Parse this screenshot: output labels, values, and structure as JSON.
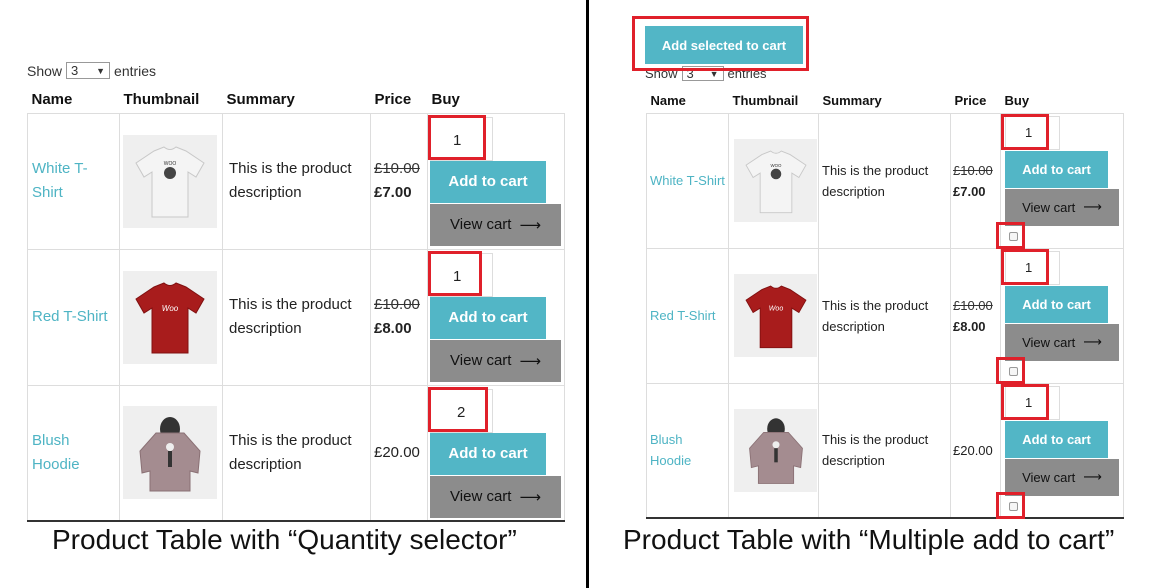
{
  "left": {
    "show_label": "Show",
    "entries_value": "3",
    "entries_label": "entries",
    "headers": {
      "name": "Name",
      "thumbnail": "Thumbnail",
      "summary": "Summary",
      "price": "Price",
      "buy": "Buy"
    },
    "rows": [
      {
        "name_line1": "White T-",
        "name_line2": "Shirt",
        "summary_line1": "This is the product",
        "summary_line2": "description",
        "price_old": "£10.00",
        "price_new": "£7.00",
        "qty": "1",
        "add_label": "Add to cart",
        "view_label": "View cart",
        "thumb_icon": "white-tshirt-image"
      },
      {
        "name_line1": "Red T-Shirt",
        "name_line2": "",
        "summary_line1": "This is the product",
        "summary_line2": "description",
        "price_old": "£10.00",
        "price_new": "£8.00",
        "qty": "1",
        "add_label": "Add to cart",
        "view_label": "View cart",
        "thumb_icon": "red-tshirt-image",
        "thumb_text": "Woo"
      },
      {
        "name_line1": "Blush",
        "name_line2": "Hoodie",
        "summary_line1": "This is the product",
        "summary_line2": "description",
        "price_old": "",
        "price_new": "£20.00",
        "qty": "2",
        "add_label": "Add to cart",
        "view_label": "View cart",
        "thumb_icon": "blush-hoodie-image"
      }
    ],
    "caption": "Product Table with “Quantity selector”"
  },
  "right": {
    "add_selected_label": "Add selected to cart",
    "show_label": "Show",
    "entries_value": "3",
    "entries_label": "entries",
    "headers": {
      "name": "Name",
      "thumbnail": "Thumbnail",
      "summary": "Summary",
      "price": "Price",
      "buy": "Buy"
    },
    "rows": [
      {
        "name_line1": "White T-Shirt",
        "name_line2": "",
        "summary_line1": "This is the product",
        "summary_line2": "description",
        "price_old": "£10.00",
        "price_new": "£7.00",
        "qty": "1",
        "add_label": "Add to cart",
        "view_label": "View cart",
        "thumb_icon": "white-tshirt-image"
      },
      {
        "name_line1": "Red T-Shirt",
        "name_line2": "",
        "summary_line1": "This is the product",
        "summary_line2": "description",
        "price_old": "£10.00",
        "price_new": "£8.00",
        "qty": "1",
        "add_label": "Add to cart",
        "view_label": "View cart",
        "thumb_icon": "red-tshirt-image",
        "thumb_text": "Woo"
      },
      {
        "name_line1": "Blush",
        "name_line2": "Hoodie",
        "summary_line1": "This is the product",
        "summary_line2": "description",
        "price_old": "",
        "price_new": "£20.00",
        "qty": "1",
        "add_label": "Add to cart",
        "view_label": "View cart",
        "thumb_icon": "blush-hoodie-image"
      }
    ],
    "caption": "Product Table with “Multiple add to cart”"
  },
  "colors": {
    "accent": "#52b6c6",
    "link": "#4eb4c4",
    "view_cart": "#8c8c8c",
    "highlight": "#e0202a",
    "red_shirt": "#a81c1c",
    "hoodie": "#a48c90"
  }
}
